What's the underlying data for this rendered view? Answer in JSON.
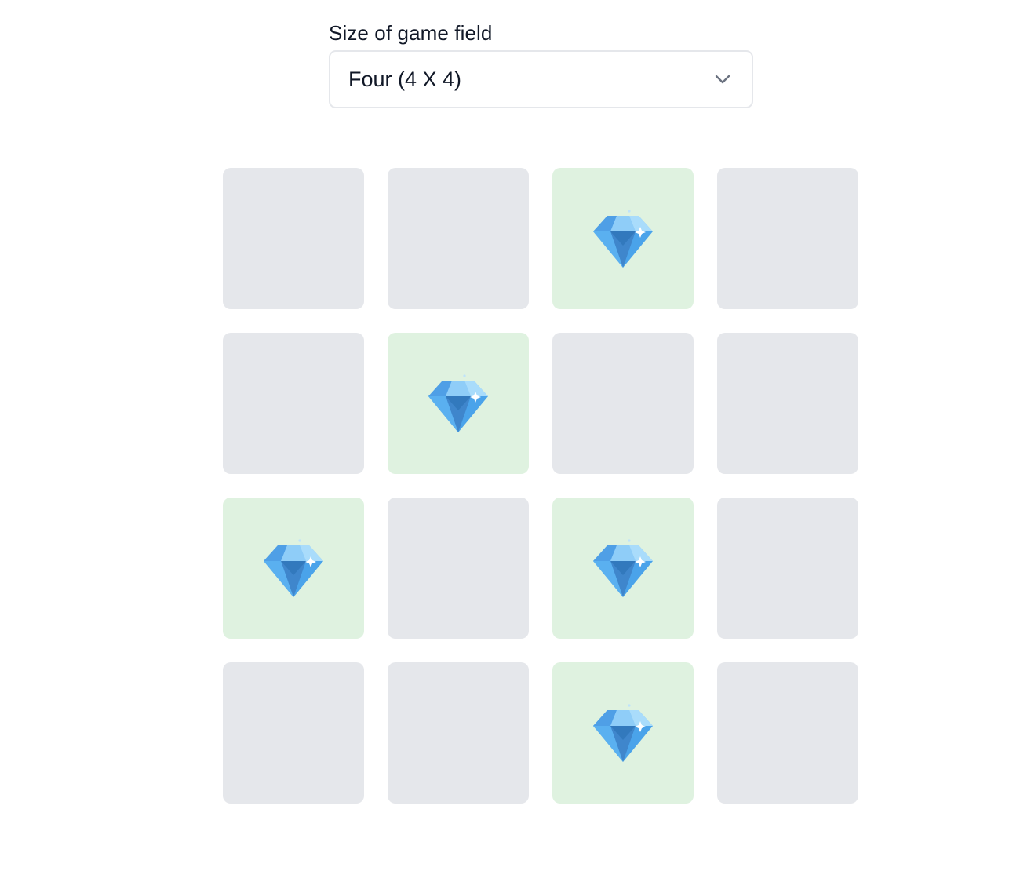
{
  "settings": {
    "label": "Size of game field",
    "selected": "Four (4 X 4)"
  },
  "board": {
    "rows": 4,
    "cols": 4,
    "cells": [
      {
        "state": "hidden"
      },
      {
        "state": "hidden"
      },
      {
        "state": "gem",
        "icon": "diamond-icon"
      },
      {
        "state": "hidden"
      },
      {
        "state": "hidden"
      },
      {
        "state": "gem",
        "icon": "diamond-icon"
      },
      {
        "state": "hidden"
      },
      {
        "state": "hidden"
      },
      {
        "state": "gem",
        "icon": "diamond-icon"
      },
      {
        "state": "hidden"
      },
      {
        "state": "gem",
        "icon": "diamond-icon"
      },
      {
        "state": "hidden"
      },
      {
        "state": "hidden"
      },
      {
        "state": "hidden"
      },
      {
        "state": "gem",
        "icon": "diamond-icon"
      },
      {
        "state": "hidden"
      }
    ]
  },
  "colors": {
    "hidden_cell": "#e5e7eb",
    "revealed_cell": "#dff2e0",
    "gem": "#4aa3ea"
  }
}
